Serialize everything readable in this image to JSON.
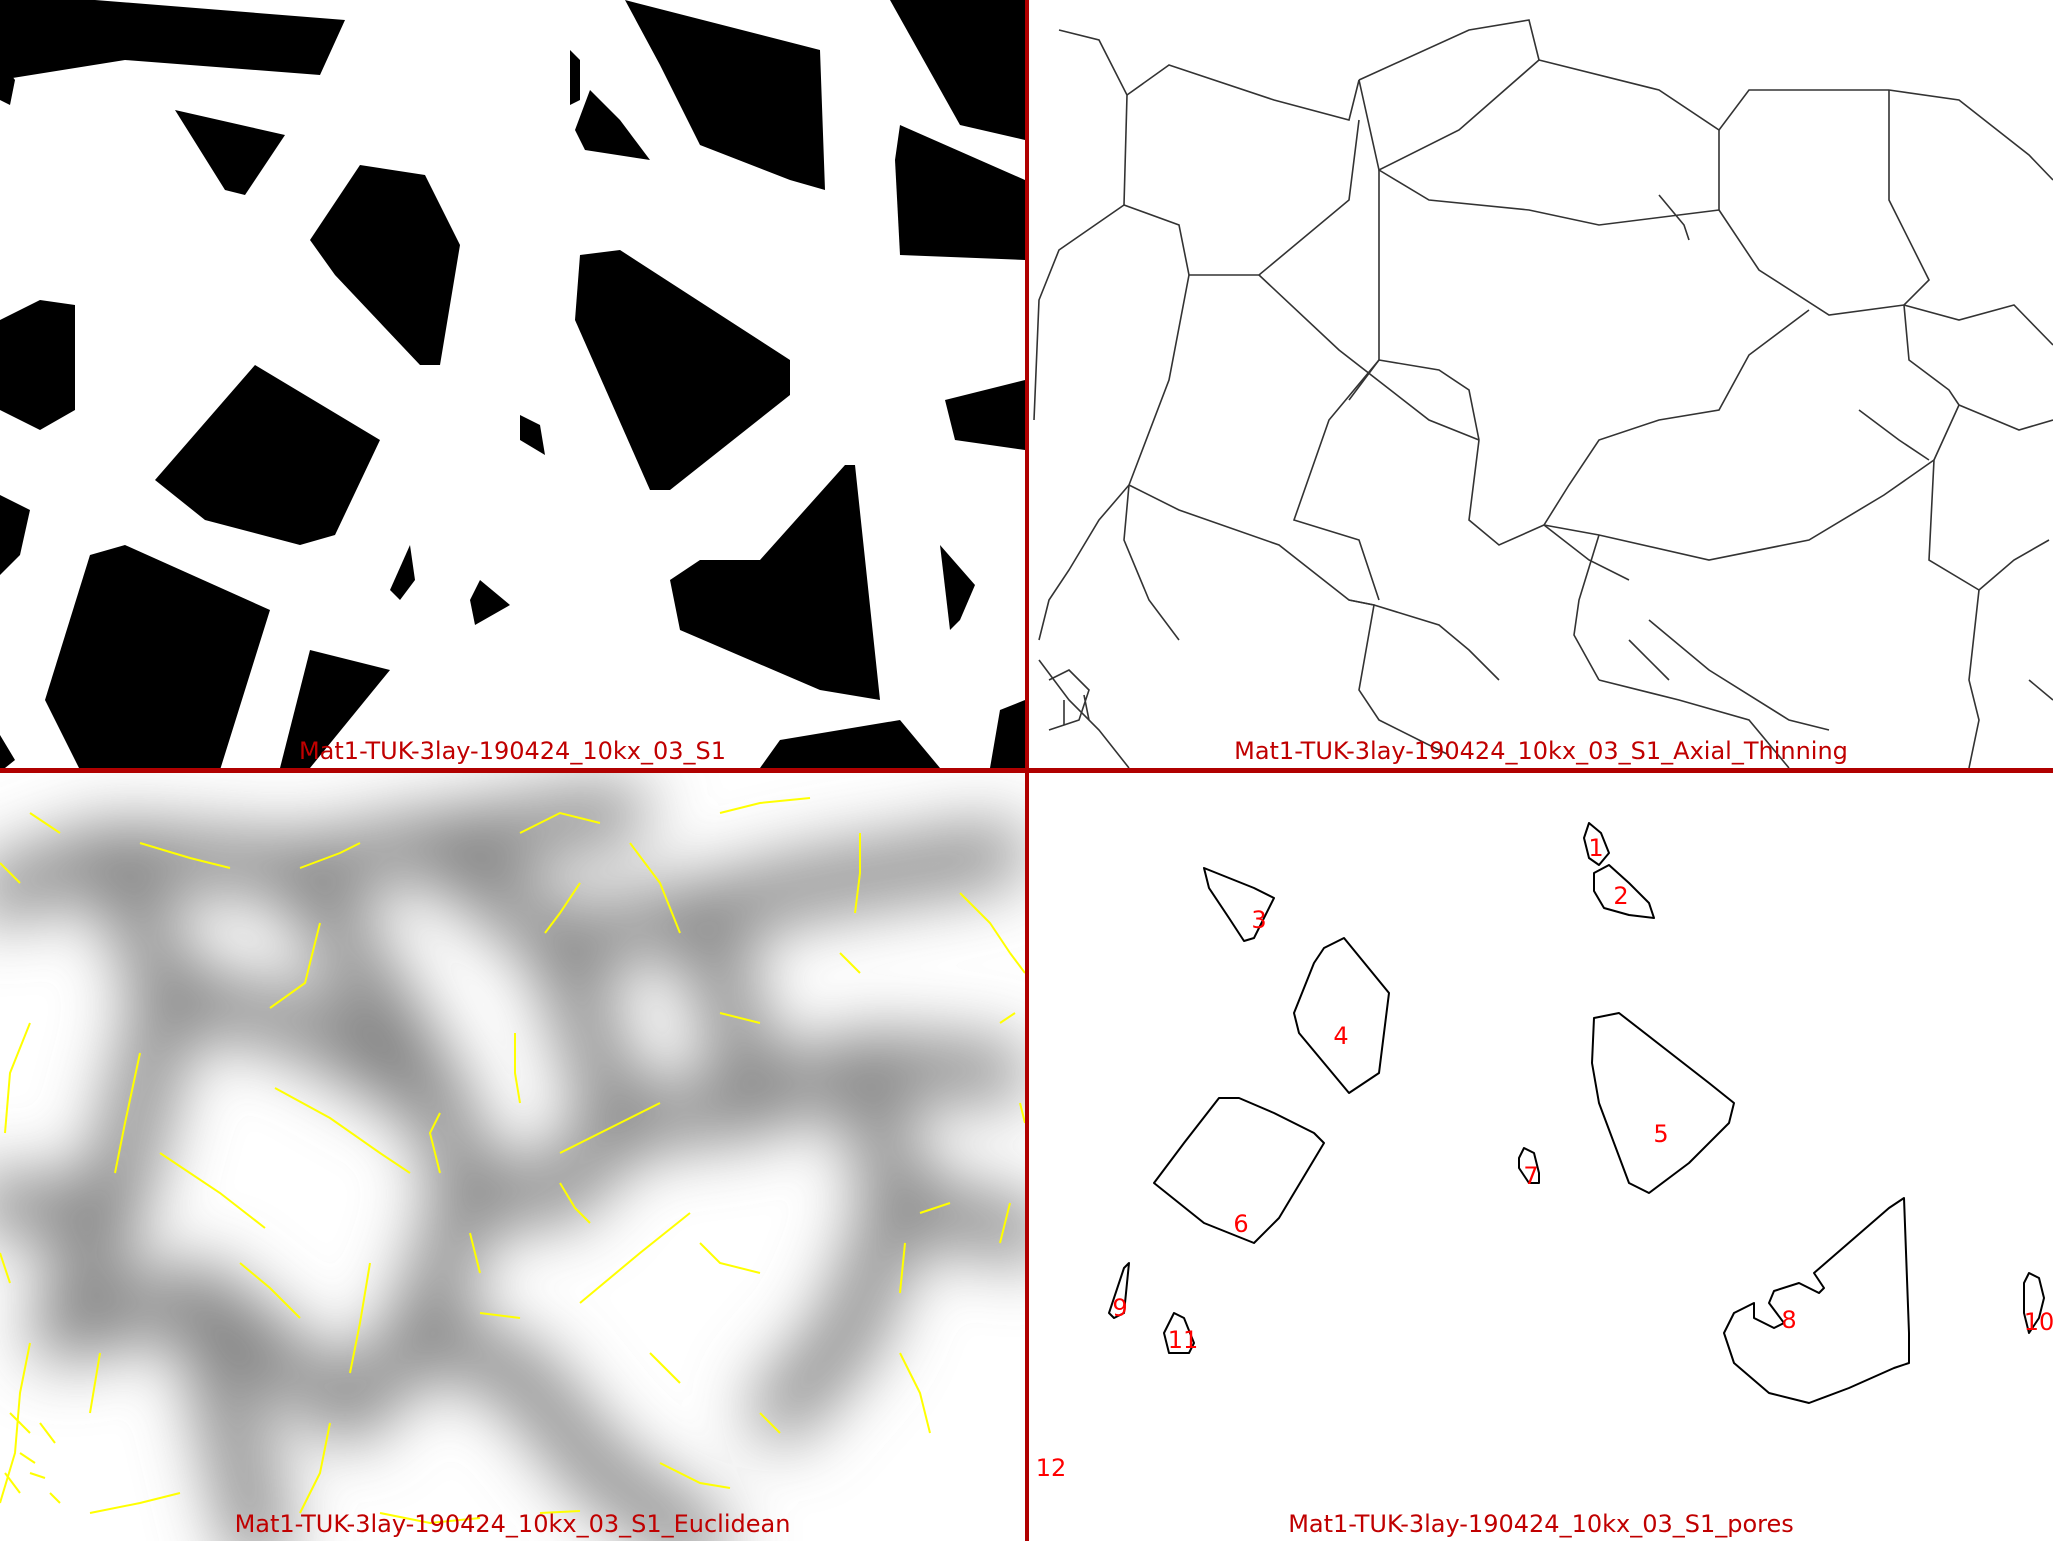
{
  "panels": {
    "binary": {
      "caption": "Mat1-TUK-3lay-190424_10kx_03_S1"
    },
    "thinning": {
      "caption": "Mat1-TUK-3lay-190424_10kx_03_S1_Axial_Thinning"
    },
    "euclidean": {
      "caption": "Mat1-TUK-3lay-190424_10kx_03_S1_Euclidean"
    },
    "pores": {
      "caption": "Mat1-TUK-3lay-190424_10kx_03_S1_pores",
      "labels": [
        "1",
        "2",
        "3",
        "4",
        "5",
        "6",
        "7",
        "8",
        "9",
        "10",
        "11",
        "12"
      ]
    }
  },
  "colors": {
    "divider": "#b00000",
    "caption": "#c00000",
    "pore_label": "#ff0000",
    "skeleton_overlay": "#ffff00"
  }
}
